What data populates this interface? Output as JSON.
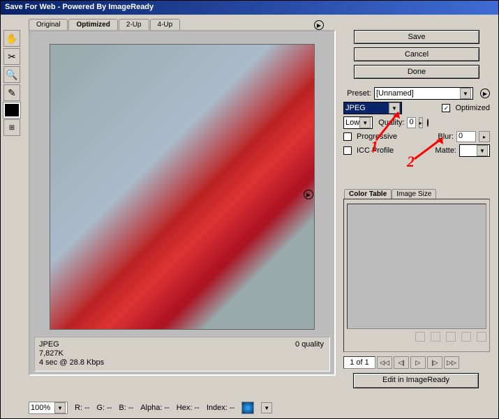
{
  "window": {
    "title": "Save For Web - Powered By ImageReady"
  },
  "tabs": [
    "Original",
    "Optimized",
    "2-Up",
    "4-Up"
  ],
  "activeTab": 1,
  "preview": {
    "format": "JPEG",
    "size": "7,827K",
    "speed": "4 sec @ 28.8 Kbps",
    "quality": "0 quality"
  },
  "buttons": {
    "save": "Save",
    "cancel": "Cancel",
    "done": "Done",
    "edit": "Edit in ImageReady"
  },
  "settings": {
    "presetLabel": "Preset:",
    "preset": "[Unnamed]",
    "format": "JPEG",
    "quality": "Low",
    "optimizedLabel": "Optimized",
    "optimized": true,
    "qualityLabel": "Quality:",
    "qualityVal": "0",
    "blurLabel": "Blur:",
    "blurVal": "0",
    "progressiveLabel": "Progressive",
    "progressive": false,
    "iccLabel": "ICC Profile",
    "icc": false,
    "matteLabel": "Matte:"
  },
  "section": {
    "tabs": [
      "Color Table",
      "Image Size"
    ],
    "active": 0
  },
  "nav": {
    "page": "1 of 1"
  },
  "status": {
    "zoom": "100%",
    "r": "R:",
    "g": "G:",
    "b": "B:",
    "alpha": "Alpha:",
    "hex": "Hex:",
    "index": "Index:",
    "dash": "--"
  },
  "ann": {
    "one": "1",
    "two": "2"
  }
}
